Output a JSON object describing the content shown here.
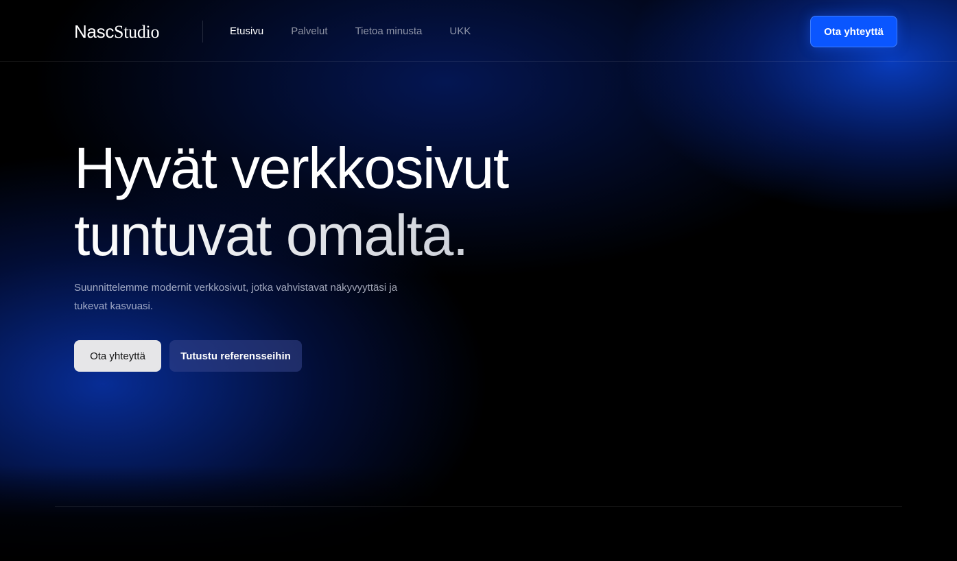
{
  "header": {
    "logo": {
      "part1": "Nasc",
      "part2": "Studio"
    },
    "nav": [
      {
        "label": "Etusivu",
        "active": true
      },
      {
        "label": "Palvelut",
        "active": false
      },
      {
        "label": "Tietoa minusta",
        "active": false
      },
      {
        "label": "UKK",
        "active": false
      }
    ],
    "cta_label": "Ota yhteyttä"
  },
  "hero": {
    "title_line1": "Hyvät verkkosivut",
    "title_line2": "tuntuvat omalta.",
    "subtitle": "Suunnittelemme modernit verkkosivut, jotka vahvistavat näkyvyyttäsi ja tukevat kasvuasi.",
    "primary_button": "Ota yhteyttä",
    "secondary_button": "Tutustu referensseihin"
  },
  "colors": {
    "accent": "#0a56ff",
    "background": "#000000",
    "glow": "#0a46dc"
  }
}
